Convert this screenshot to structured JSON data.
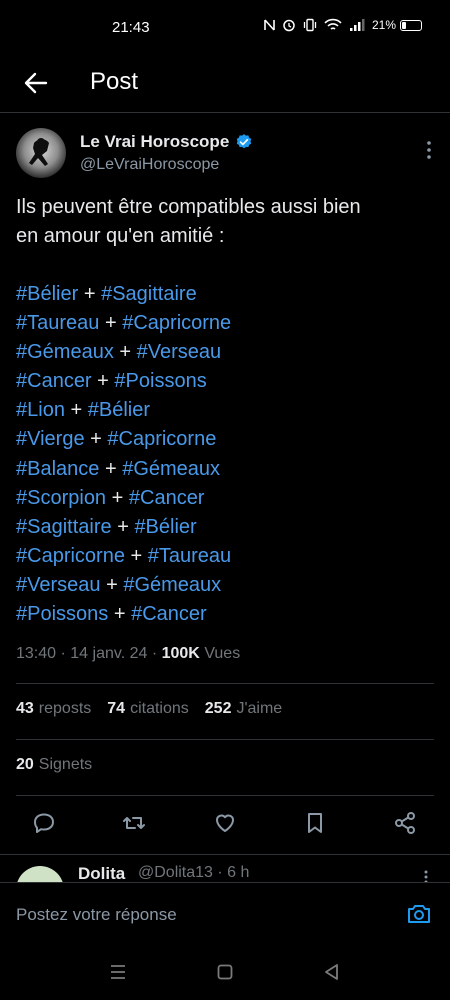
{
  "status_bar": {
    "time": "21:43",
    "battery": "21%",
    "battery_level": 0.21
  },
  "header": {
    "title": "Post"
  },
  "author": {
    "name": "Le Vrai Horoscope",
    "handle": "@LeVraiHoroscope"
  },
  "tweet": {
    "lines": [
      "Ils peuvent être compatibles aussi bien",
      "en amour qu'en amitié :"
    ],
    "pairs": [
      [
        "#Bélier",
        "#Sagittaire"
      ],
      [
        "#Taureau",
        "#Capricorne"
      ],
      [
        "#Gémeaux",
        "#Verseau"
      ],
      [
        "#Cancer",
        "#Poissons"
      ],
      [
        "#Lion",
        "#Bélier"
      ],
      [
        "#Vierge",
        "#Capricorne"
      ],
      [
        "#Balance",
        "#Gémeaux"
      ],
      [
        "#Scorpion",
        "#Cancer"
      ],
      [
        "#Sagittaire",
        "#Bélier"
      ],
      [
        "#Capricorne",
        "#Taureau"
      ],
      [
        "#Verseau",
        "#Gémeaux"
      ],
      [
        "#Poissons",
        "#Cancer"
      ]
    ],
    "plus": "+"
  },
  "meta": {
    "time": "13:40",
    "dot": "·",
    "date": "14 janv. 24",
    "views_count": "100K",
    "views_label": "Vues"
  },
  "stats": {
    "reposts_count": "43",
    "reposts_label": "reposts",
    "quotes_count": "74",
    "quotes_label": "citations",
    "likes_count": "252",
    "likes_label": "J'aime"
  },
  "bookmarks": {
    "count": "20",
    "label": "Signets"
  },
  "reply": {
    "name": "Dolita",
    "handle": "@Dolita13 · 6 h"
  },
  "composer": {
    "placeholder": "Postez votre réponse"
  },
  "colors": {
    "background": "#000000",
    "accent": "#1d9bf0",
    "hashtag": "#4a99e9",
    "muted": "#71767b",
    "divider": "#2f3336"
  },
  "icons": [
    "back-arrow-icon",
    "verified-icon",
    "more-icon",
    "reply-icon",
    "repost-icon",
    "like-icon",
    "bookmark-icon",
    "share-icon",
    "camera-icon"
  ]
}
